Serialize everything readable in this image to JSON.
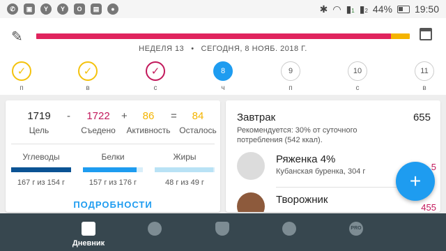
{
  "statusbar": {
    "left_icons": [
      "phone-icon",
      "message-icon",
      "yandex-icon",
      "yandex-icon",
      "outlook-icon",
      "photo-icon",
      "notification-icon"
    ],
    "left_glyphs": [
      "✆",
      "▣",
      "Y",
      "Y",
      "O",
      "▤",
      "●"
    ],
    "sim1": "1",
    "sim2": "2",
    "battery": "44%",
    "time": "19:50"
  },
  "header": {
    "progress_fraction": 0.95,
    "week_label": "НЕДЕЛЯ 13",
    "date_label": "СЕГОДНЯ, 8 НОЯБ. 2018 Г.",
    "days": [
      {
        "value": "✓",
        "label": "п",
        "state": "yellow"
      },
      {
        "value": "✓",
        "label": "в",
        "state": "yellow"
      },
      {
        "value": "✓",
        "label": "с",
        "state": "pink"
      },
      {
        "value": "8",
        "label": "ч",
        "state": "active"
      },
      {
        "value": "9",
        "label": "п",
        "state": ""
      },
      {
        "value": "10",
        "label": "с",
        "state": ""
      },
      {
        "value": "11",
        "label": "в",
        "state": ""
      }
    ]
  },
  "summary": {
    "goal": {
      "value": "1719",
      "label": "Цель",
      "color": "#212121"
    },
    "minus": "-",
    "eaten": {
      "value": "1722",
      "label": "Съедено",
      "color": "#c2185b"
    },
    "plus": "+",
    "activity": {
      "value": "86",
      "label": "Активность",
      "color": "#f4b400"
    },
    "equals": "=",
    "remaining": {
      "value": "84",
      "label": "Осталось",
      "color": "#f4b400"
    },
    "macros": [
      {
        "name": "Углеводы",
        "amount": "167 г из 154 г",
        "fill_fraction": 1.0,
        "color": "#0b5394"
      },
      {
        "name": "Белки",
        "amount": "157 г из 176 г",
        "fill_fraction": 0.89,
        "color": "#1e9cf0"
      },
      {
        "name": "Жиры",
        "amount": "48 г из 49 г",
        "fill_fraction": 0.98,
        "color": "#b9e2f5"
      }
    ],
    "details_label": "ПОДРОБНОСТИ"
  },
  "meal": {
    "title": "Завтрак",
    "calories": "655",
    "recommendation": "Рекомендуется: 30% от суточного потребления (542 ккал).",
    "items": [
      {
        "name": "Ряженка 4%",
        "sub": "Кубанская буренка, 304 г",
        "calories": "5",
        "img_color": "#dcdcdc"
      },
      {
        "name": "Творожник",
        "sub": "",
        "calories": "455",
        "img_color": "#8d5a3c"
      }
    ]
  },
  "fab_label": "+",
  "bottomnav": [
    {
      "label": "Дневник",
      "icon": "diary-icon"
    },
    {
      "label": "",
      "icon": "recipes-icon"
    },
    {
      "label": "",
      "icon": "shield-icon"
    },
    {
      "label": "",
      "icon": "profile-icon"
    },
    {
      "label": "",
      "icon": "pro-icon",
      "glyph": "PRO"
    }
  ]
}
